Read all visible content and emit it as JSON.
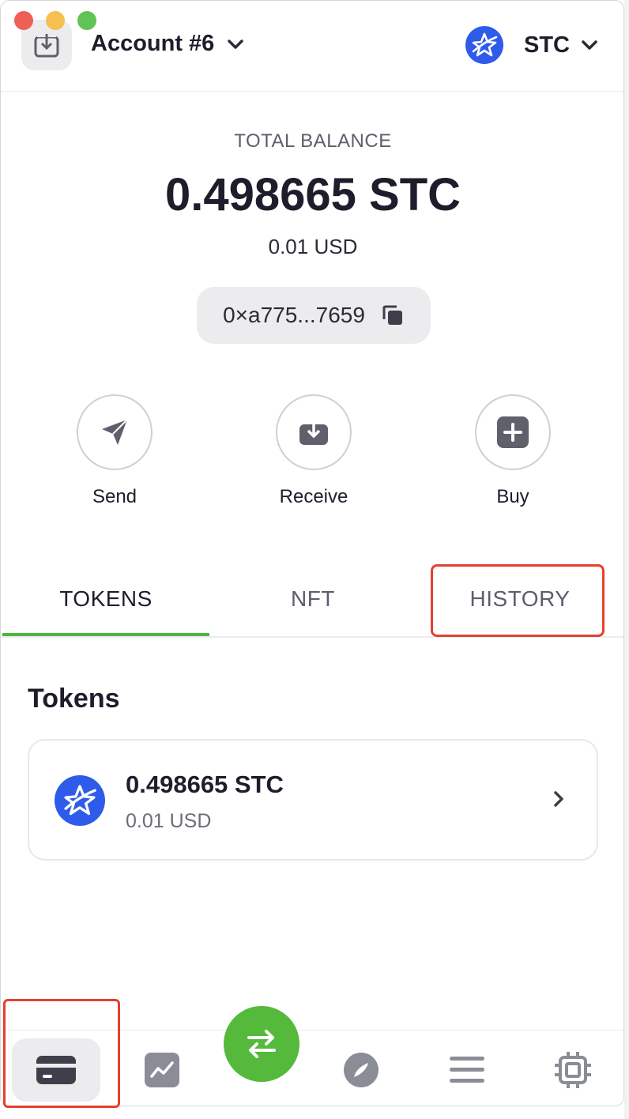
{
  "header": {
    "account_label": "Account #6",
    "network_label": "STC"
  },
  "balance": {
    "total_label": "TOTAL BALANCE",
    "amount": "0.498665 STC",
    "usd": "0.01 USD",
    "address": "0×a775...7659"
  },
  "actions": {
    "send": "Send",
    "receive": "Receive",
    "buy": "Buy"
  },
  "tabs": {
    "tokens": "TOKENS",
    "nft": "NFT",
    "history": "HISTORY",
    "active": "TOKENS"
  },
  "tokens_section": {
    "title": "Tokens",
    "items": [
      {
        "amount": "0.498665 STC",
        "usd": "0.01 USD",
        "icon": "starcoin-logo"
      }
    ]
  },
  "bottom_nav": {
    "items": [
      "wallet-icon",
      "chart-icon",
      "swap-icon",
      "explore-icon",
      "menu-icon",
      "settings-icon"
    ],
    "active": "wallet-icon"
  },
  "colors": {
    "accent_green": "#55b93c",
    "tab_indicator": "#4db641",
    "brand_blue": "#2f5bea",
    "highlight_red": "#e5402f"
  }
}
